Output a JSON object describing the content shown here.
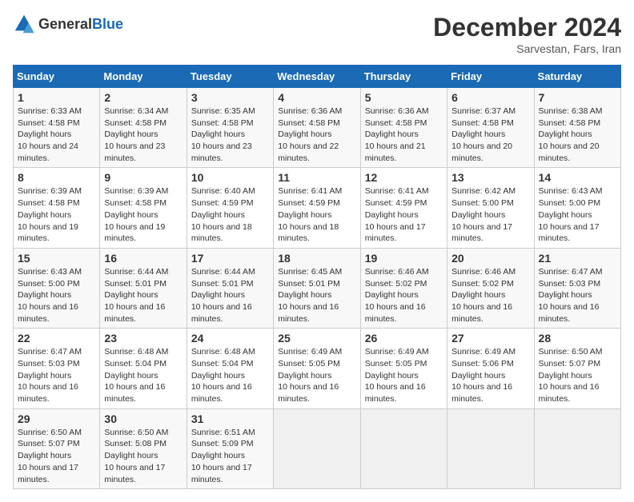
{
  "header": {
    "logo_general": "General",
    "logo_blue": "Blue",
    "title": "December 2024",
    "location": "Sarvestan, Fars, Iran"
  },
  "weekdays": [
    "Sunday",
    "Monday",
    "Tuesday",
    "Wednesday",
    "Thursday",
    "Friday",
    "Saturday"
  ],
  "weeks": [
    [
      {
        "day": "1",
        "sunrise": "6:33 AM",
        "sunset": "4:58 PM",
        "daylight": "10 hours and 24 minutes."
      },
      {
        "day": "2",
        "sunrise": "6:34 AM",
        "sunset": "4:58 PM",
        "daylight": "10 hours and 23 minutes."
      },
      {
        "day": "3",
        "sunrise": "6:35 AM",
        "sunset": "4:58 PM",
        "daylight": "10 hours and 23 minutes."
      },
      {
        "day": "4",
        "sunrise": "6:36 AM",
        "sunset": "4:58 PM",
        "daylight": "10 hours and 22 minutes."
      },
      {
        "day": "5",
        "sunrise": "6:36 AM",
        "sunset": "4:58 PM",
        "daylight": "10 hours and 21 minutes."
      },
      {
        "day": "6",
        "sunrise": "6:37 AM",
        "sunset": "4:58 PM",
        "daylight": "10 hours and 20 minutes."
      },
      {
        "day": "7",
        "sunrise": "6:38 AM",
        "sunset": "4:58 PM",
        "daylight": "10 hours and 20 minutes."
      }
    ],
    [
      {
        "day": "8",
        "sunrise": "6:39 AM",
        "sunset": "4:58 PM",
        "daylight": "10 hours and 19 minutes."
      },
      {
        "day": "9",
        "sunrise": "6:39 AM",
        "sunset": "4:58 PM",
        "daylight": "10 hours and 19 minutes."
      },
      {
        "day": "10",
        "sunrise": "6:40 AM",
        "sunset": "4:59 PM",
        "daylight": "10 hours and 18 minutes."
      },
      {
        "day": "11",
        "sunrise": "6:41 AM",
        "sunset": "4:59 PM",
        "daylight": "10 hours and 18 minutes."
      },
      {
        "day": "12",
        "sunrise": "6:41 AM",
        "sunset": "4:59 PM",
        "daylight": "10 hours and 17 minutes."
      },
      {
        "day": "13",
        "sunrise": "6:42 AM",
        "sunset": "5:00 PM",
        "daylight": "10 hours and 17 minutes."
      },
      {
        "day": "14",
        "sunrise": "6:43 AM",
        "sunset": "5:00 PM",
        "daylight": "10 hours and 17 minutes."
      }
    ],
    [
      {
        "day": "15",
        "sunrise": "6:43 AM",
        "sunset": "5:00 PM",
        "daylight": "10 hours and 16 minutes."
      },
      {
        "day": "16",
        "sunrise": "6:44 AM",
        "sunset": "5:01 PM",
        "daylight": "10 hours and 16 minutes."
      },
      {
        "day": "17",
        "sunrise": "6:44 AM",
        "sunset": "5:01 PM",
        "daylight": "10 hours and 16 minutes."
      },
      {
        "day": "18",
        "sunrise": "6:45 AM",
        "sunset": "5:01 PM",
        "daylight": "10 hours and 16 minutes."
      },
      {
        "day": "19",
        "sunrise": "6:46 AM",
        "sunset": "5:02 PM",
        "daylight": "10 hours and 16 minutes."
      },
      {
        "day": "20",
        "sunrise": "6:46 AM",
        "sunset": "5:02 PM",
        "daylight": "10 hours and 16 minutes."
      },
      {
        "day": "21",
        "sunrise": "6:47 AM",
        "sunset": "5:03 PM",
        "daylight": "10 hours and 16 minutes."
      }
    ],
    [
      {
        "day": "22",
        "sunrise": "6:47 AM",
        "sunset": "5:03 PM",
        "daylight": "10 hours and 16 minutes."
      },
      {
        "day": "23",
        "sunrise": "6:48 AM",
        "sunset": "5:04 PM",
        "daylight": "10 hours and 16 minutes."
      },
      {
        "day": "24",
        "sunrise": "6:48 AM",
        "sunset": "5:04 PM",
        "daylight": "10 hours and 16 minutes."
      },
      {
        "day": "25",
        "sunrise": "6:49 AM",
        "sunset": "5:05 PM",
        "daylight": "10 hours and 16 minutes."
      },
      {
        "day": "26",
        "sunrise": "6:49 AM",
        "sunset": "5:05 PM",
        "daylight": "10 hours and 16 minutes."
      },
      {
        "day": "27",
        "sunrise": "6:49 AM",
        "sunset": "5:06 PM",
        "daylight": "10 hours and 16 minutes."
      },
      {
        "day": "28",
        "sunrise": "6:50 AM",
        "sunset": "5:07 PM",
        "daylight": "10 hours and 16 minutes."
      }
    ],
    [
      {
        "day": "29",
        "sunrise": "6:50 AM",
        "sunset": "5:07 PM",
        "daylight": "10 hours and 17 minutes."
      },
      {
        "day": "30",
        "sunrise": "6:50 AM",
        "sunset": "5:08 PM",
        "daylight": "10 hours and 17 minutes."
      },
      {
        "day": "31",
        "sunrise": "6:51 AM",
        "sunset": "5:09 PM",
        "daylight": "10 hours and 17 minutes."
      },
      null,
      null,
      null,
      null
    ]
  ]
}
